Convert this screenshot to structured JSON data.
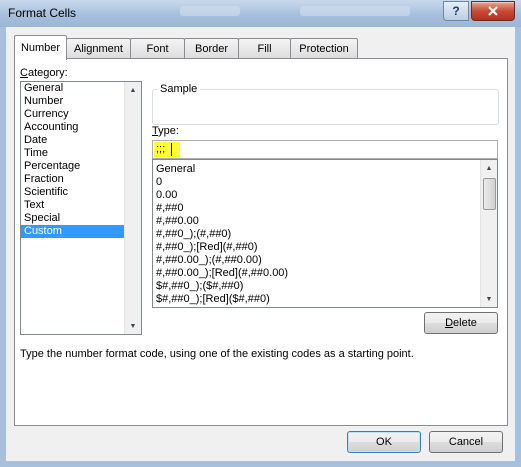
{
  "window": {
    "title": "Format Cells",
    "help_label": "?"
  },
  "tabs": [
    {
      "label": "Number"
    },
    {
      "label": "Alignment"
    },
    {
      "label": "Font"
    },
    {
      "label": "Border"
    },
    {
      "label": "Fill"
    },
    {
      "label": "Protection"
    }
  ],
  "category": {
    "label_accel": "C",
    "label_rest": "ategory:",
    "items": [
      "General",
      "Number",
      "Currency",
      "Accounting",
      "Date",
      "Time",
      "Percentage",
      "Fraction",
      "Scientific",
      "Text",
      "Special",
      "Custom"
    ],
    "selected": "Custom"
  },
  "sample": {
    "label": "Sample",
    "value": ""
  },
  "type": {
    "label_accel": "T",
    "label_rest": "ype:",
    "value": ";;;"
  },
  "format_codes": [
    "General",
    "0",
    "0.00",
    "#,##0",
    "#,##0.00",
    "#,##0_);(#,##0)",
    "#,##0_);[Red](#,##0)",
    "#,##0.00_);(#,##0.00)",
    "#,##0.00_);[Red](#,##0.00)",
    "$#,##0_);($#,##0)",
    "$#,##0_);[Red]($#,##0)"
  ],
  "buttons": {
    "delete_accel": "D",
    "delete_rest": "elete",
    "ok": "OK",
    "cancel": "Cancel"
  },
  "hint": "Type the number format code, using one of the existing codes as a starting point.",
  "colors": {
    "selection": "#3399ff",
    "type_highlight": "#ffff33",
    "close_button": "#c84a36"
  }
}
